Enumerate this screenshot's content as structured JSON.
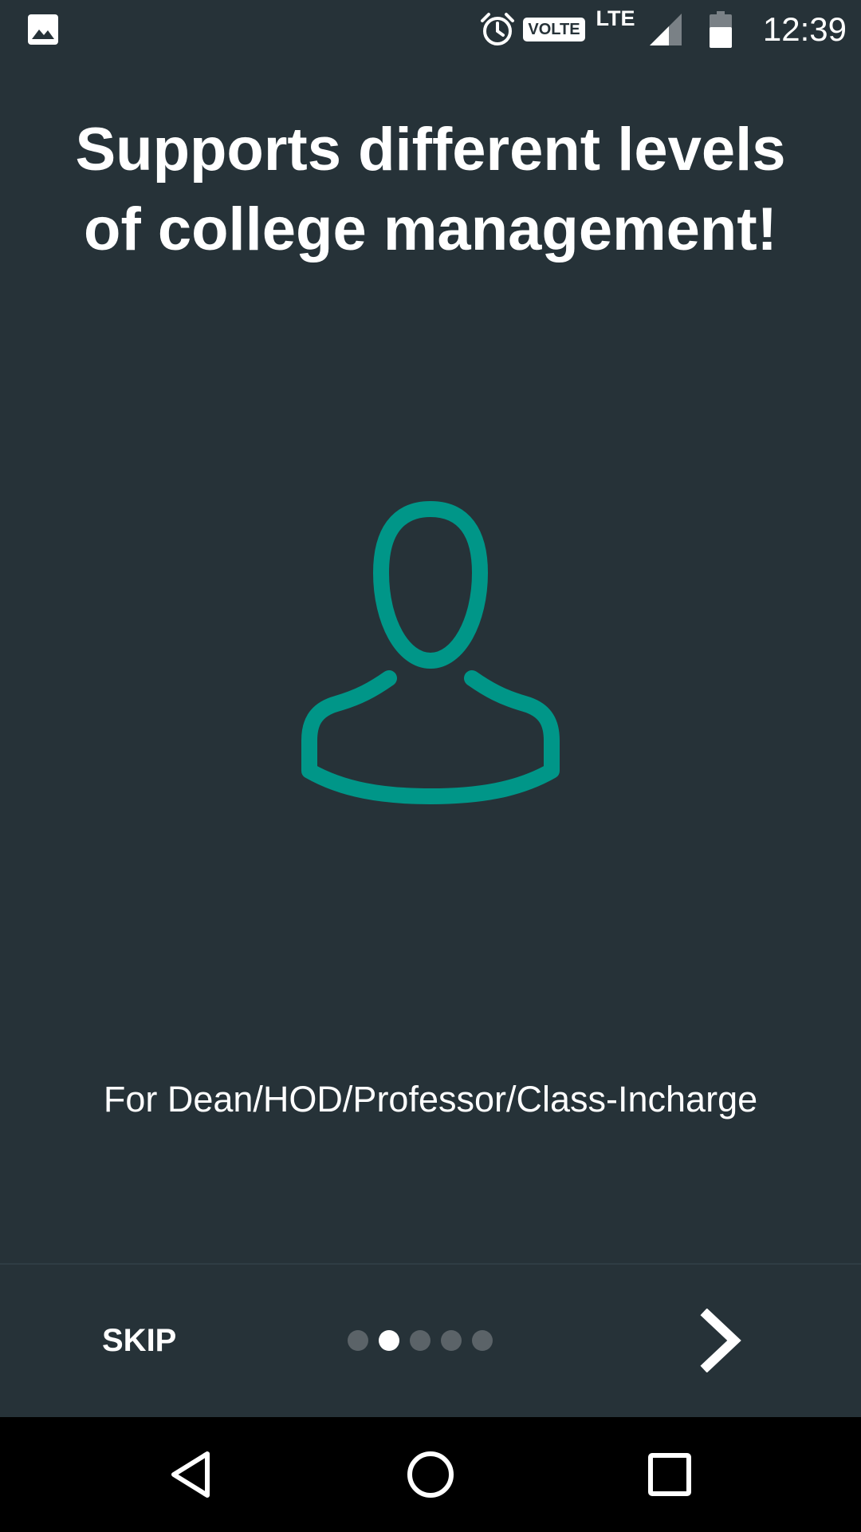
{
  "status_bar": {
    "time": "12:39",
    "volte": "VOLTE",
    "network": "LTE",
    "icons": [
      "gallery-icon",
      "alarm-icon",
      "signal-icon",
      "battery-icon"
    ]
  },
  "onboarding": {
    "title": "Supports different levels of college management!",
    "illustration_icon": "user-silhouette-icon",
    "description": "For Dean/HOD/Professor/Class-Incharge",
    "skip_label": "SKIP",
    "page_count": 5,
    "current_page": 2,
    "next_icon": "chevron-right-icon"
  },
  "nav_bar": {
    "icons": [
      "back-icon",
      "home-icon",
      "recents-icon"
    ]
  },
  "colors": {
    "background": "#263238",
    "accent": "#009688",
    "text": "#ffffff",
    "inactive_dot": "#5b6368"
  }
}
